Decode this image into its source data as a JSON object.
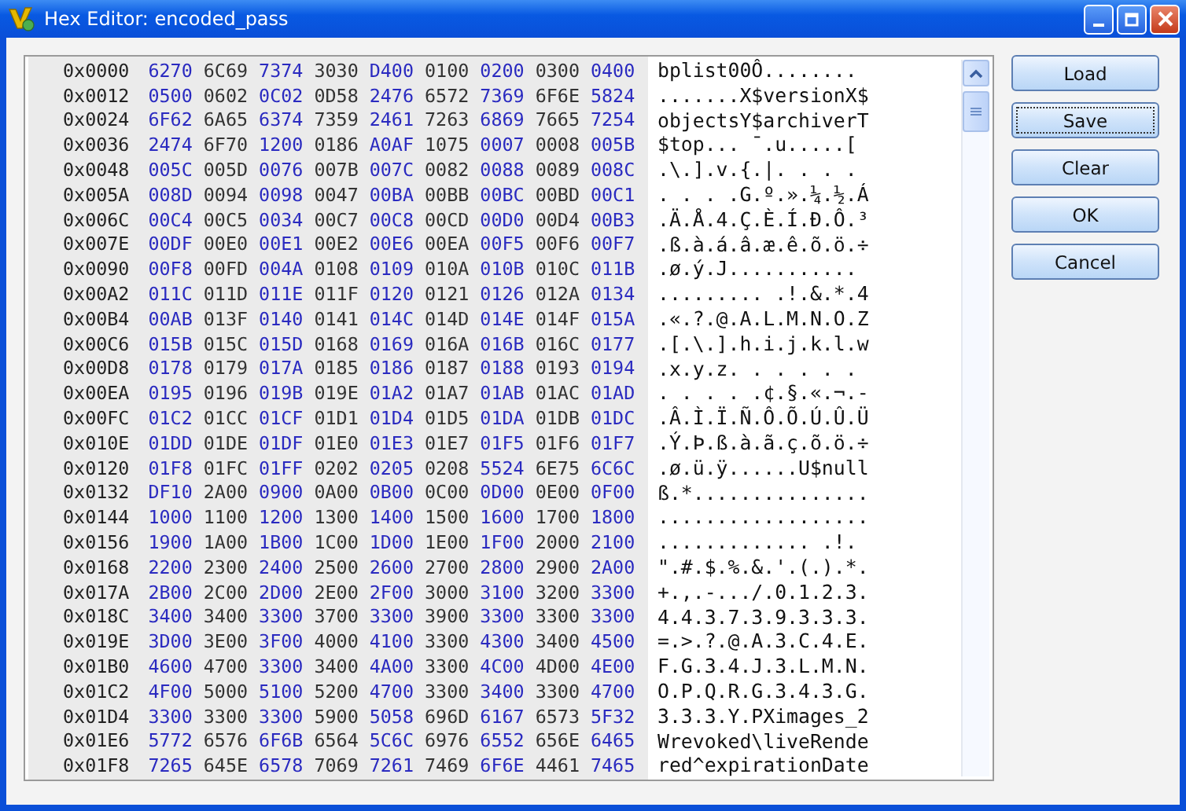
{
  "window": {
    "title": "Hex Editor: encoded_pass"
  },
  "hex_view": {
    "rows": [
      {
        "address": "0x0000",
        "words": [
          "6270",
          "6C69",
          "7374",
          "3030",
          "D400",
          "0100",
          "0200",
          "0300",
          "0400"
        ],
        "ascii": "bplist00Ô........"
      },
      {
        "address": "0x0012",
        "words": [
          "0500",
          "0602",
          "0C02",
          "0D58",
          "2476",
          "6572",
          "7369",
          "6F6E",
          "5824"
        ],
        "ascii": ".......X$versionX$"
      },
      {
        "address": "0x0024",
        "words": [
          "6F62",
          "6A65",
          "6374",
          "7359",
          "2461",
          "7263",
          "6869",
          "7665",
          "7254"
        ],
        "ascii": "objectsY$archiverT"
      },
      {
        "address": "0x0036",
        "words": [
          "2474",
          "6F70",
          "1200",
          "0186",
          "A0AF",
          "1075",
          "0007",
          "0008",
          "005B"
        ],
        "ascii": "$top... ¯.u.....["
      },
      {
        "address": "0x0048",
        "words": [
          "005C",
          "005D",
          "0076",
          "007B",
          "007C",
          "0082",
          "0088",
          "0089",
          "008C"
        ],
        "ascii": ".\\.].v.{.|. . . ."
      },
      {
        "address": "0x005A",
        "words": [
          "008D",
          "0094",
          "0098",
          "0047",
          "00BA",
          "00BB",
          "00BC",
          "00BD",
          "00C1"
        ],
        "ascii": ". . . .G.º.».¼.½.Á"
      },
      {
        "address": "0x006C",
        "words": [
          "00C4",
          "00C5",
          "0034",
          "00C7",
          "00C8",
          "00CD",
          "00D0",
          "00D4",
          "00B3"
        ],
        "ascii": ".Ä.Å.4.Ç.È.Í.Ð.Ô.³"
      },
      {
        "address": "0x007E",
        "words": [
          "00DF",
          "00E0",
          "00E1",
          "00E2",
          "00E6",
          "00EA",
          "00F5",
          "00F6",
          "00F7"
        ],
        "ascii": ".ß.à.á.â.æ.ê.õ.ö.÷"
      },
      {
        "address": "0x0090",
        "words": [
          "00F8",
          "00FD",
          "004A",
          "0108",
          "0109",
          "010A",
          "010B",
          "010C",
          "011B"
        ],
        "ascii": ".ø.ý.J..........."
      },
      {
        "address": "0x00A2",
        "words": [
          "011C",
          "011D",
          "011E",
          "011F",
          "0120",
          "0121",
          "0126",
          "012A",
          "0134"
        ],
        "ascii": "......... .!.&.*.4"
      },
      {
        "address": "0x00B4",
        "words": [
          "00AB",
          "013F",
          "0140",
          "0141",
          "014C",
          "014D",
          "014E",
          "014F",
          "015A"
        ],
        "ascii": ".«.?.@.A.L.M.N.O.Z"
      },
      {
        "address": "0x00C6",
        "words": [
          "015B",
          "015C",
          "015D",
          "0168",
          "0169",
          "016A",
          "016B",
          "016C",
          "0177"
        ],
        "ascii": ".[.\\.].h.i.j.k.l.w"
      },
      {
        "address": "0x00D8",
        "words": [
          "0178",
          "0179",
          "017A",
          "0185",
          "0186",
          "0187",
          "0188",
          "0193",
          "0194"
        ],
        "ascii": ".x.y.z. . . . . ."
      },
      {
        "address": "0x00EA",
        "words": [
          "0195",
          "0196",
          "019B",
          "019E",
          "01A2",
          "01A7",
          "01AB",
          "01AC",
          "01AD"
        ],
        "ascii": ". . . . .¢.§.«.¬.-"
      },
      {
        "address": "0x00FC",
        "words": [
          "01C2",
          "01CC",
          "01CF",
          "01D1",
          "01D4",
          "01D5",
          "01DA",
          "01DB",
          "01DC"
        ],
        "ascii": ".Â.Ì.Ï.Ñ.Ô.Õ.Ú.Û.Ü"
      },
      {
        "address": "0x010E",
        "words": [
          "01DD",
          "01DE",
          "01DF",
          "01E0",
          "01E3",
          "01E7",
          "01F5",
          "01F6",
          "01F7"
        ],
        "ascii": ".Ý.Þ.ß.à.ã.ç.õ.ö.÷"
      },
      {
        "address": "0x0120",
        "words": [
          "01F8",
          "01FC",
          "01FF",
          "0202",
          "0205",
          "0208",
          "5524",
          "6E75",
          "6C6C"
        ],
        "ascii": ".ø.ü.ÿ......U$null"
      },
      {
        "address": "0x0132",
        "words": [
          "DF10",
          "2A00",
          "0900",
          "0A00",
          "0B00",
          "0C00",
          "0D00",
          "0E00",
          "0F00"
        ],
        "ascii": "ß.*..............."
      },
      {
        "address": "0x0144",
        "words": [
          "1000",
          "1100",
          "1200",
          "1300",
          "1400",
          "1500",
          "1600",
          "1700",
          "1800"
        ],
        "ascii": ".................."
      },
      {
        "address": "0x0156",
        "words": [
          "1900",
          "1A00",
          "1B00",
          "1C00",
          "1D00",
          "1E00",
          "1F00",
          "2000",
          "2100"
        ],
        "ascii": "............. .!."
      },
      {
        "address": "0x0168",
        "words": [
          "2200",
          "2300",
          "2400",
          "2500",
          "2600",
          "2700",
          "2800",
          "2900",
          "2A00"
        ],
        "ascii": "\".#.$.%.&.'.(.).*."
      },
      {
        "address": "0x017A",
        "words": [
          "2B00",
          "2C00",
          "2D00",
          "2E00",
          "2F00",
          "3000",
          "3100",
          "3200",
          "3300"
        ],
        "ascii": "+.,.-.../.0.1.2.3."
      },
      {
        "address": "0x018C",
        "words": [
          "3400",
          "3400",
          "3300",
          "3700",
          "3300",
          "3900",
          "3300",
          "3300",
          "3300"
        ],
        "ascii": "4.4.3.7.3.9.3.3.3."
      },
      {
        "address": "0x019E",
        "words": [
          "3D00",
          "3E00",
          "3F00",
          "4000",
          "4100",
          "3300",
          "4300",
          "3400",
          "4500"
        ],
        "ascii": "=.>.?.@.A.3.C.4.E."
      },
      {
        "address": "0x01B0",
        "words": [
          "4600",
          "4700",
          "3300",
          "3400",
          "4A00",
          "3300",
          "4C00",
          "4D00",
          "4E00"
        ],
        "ascii": "F.G.3.4.J.3.L.M.N."
      },
      {
        "address": "0x01C2",
        "words": [
          "4F00",
          "5000",
          "5100",
          "5200",
          "4700",
          "3300",
          "3400",
          "3300",
          "4700"
        ],
        "ascii": "O.P.Q.R.G.3.4.3.G."
      },
      {
        "address": "0x01D4",
        "words": [
          "3300",
          "3300",
          "3300",
          "5900",
          "5058",
          "696D",
          "6167",
          "6573",
          "5F32"
        ],
        "ascii": "3.3.3.Y.PXimages_2"
      },
      {
        "address": "0x01E6",
        "words": [
          "5772",
          "6576",
          "6F6B",
          "6564",
          "5C6C",
          "6976",
          "6552",
          "656E",
          "6465"
        ],
        "ascii": "Wrevoked\\liveRende"
      },
      {
        "address": "0x01F8",
        "words": [
          "7265",
          "645E",
          "6578",
          "7069",
          "7261",
          "7469",
          "6F6E",
          "4461",
          "7465"
        ],
        "ascii": "red^expirationDate"
      }
    ]
  },
  "buttons": [
    {
      "label": "Load",
      "focused": false
    },
    {
      "label": "Save",
      "focused": true
    },
    {
      "label": "Clear",
      "focused": false
    },
    {
      "label": "OK",
      "focused": false
    },
    {
      "label": "Cancel",
      "focused": false
    }
  ]
}
